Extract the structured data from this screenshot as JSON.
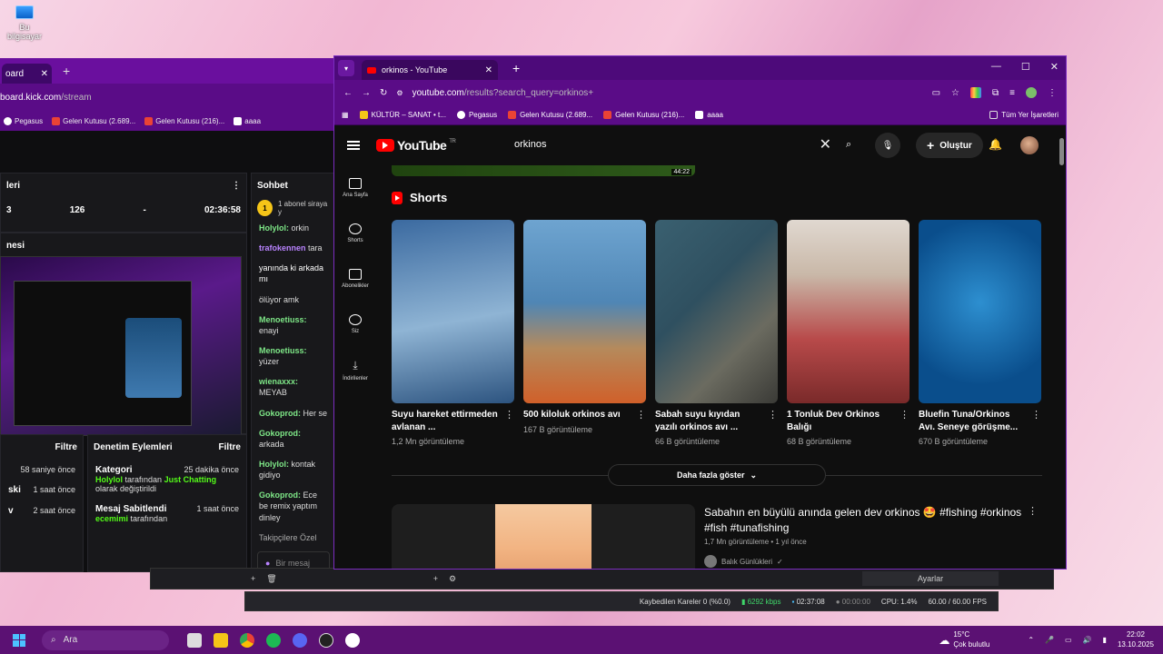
{
  "desktop": {
    "icon_label": "Bu bilgisayar"
  },
  "kick_window": {
    "tab_title": "oard",
    "url_host": "board.kick.com",
    "url_path": "/stream",
    "bookmarks": [
      {
        "label": "Pegasus",
        "color": "#ffffff"
      },
      {
        "label": "Gelen Kutusu (2.689...",
        "color": "#ea4335"
      },
      {
        "label": "Gelen Kutusu (216)...",
        "color": "#ea4335"
      },
      {
        "label": "aaaa",
        "color": "#ffffff"
      }
    ],
    "stats_header": "leri",
    "stats": [
      "3",
      "126",
      "-",
      "02:36:58"
    ],
    "preview_header": "nesi",
    "chat_header": "Sohbet",
    "subscriber_badge": "1",
    "subscriber_text": "1 abonel siraya y",
    "chat": [
      {
        "user": "Holylol:",
        "text": "orkin"
      },
      {
        "user": "trafokennen",
        "text": "tara"
      },
      {
        "user": "",
        "text": "yanında ki arkada mı"
      },
      {
        "user": "",
        "text": "ölüyor amk"
      },
      {
        "user": "Menoetiuss:",
        "text": "enayi"
      },
      {
        "user": "Menoetiuss:",
        "text": "yüzer"
      },
      {
        "user": "wienaxxx:",
        "text": "MEYAB"
      },
      {
        "user": "Gokoprod:",
        "text": "Her se"
      },
      {
        "user": "Gokoprod:",
        "text": "arkada"
      },
      {
        "user": "Holylol:",
        "text": "kontak gidiyo"
      },
      {
        "user": "Gokoprod:",
        "text": "Ece be remix yaptım dinley"
      }
    ],
    "chat_mode": "Takipçilere Özel",
    "chat_input_placeholder": "Bir mesaj",
    "left_filter": "Filtre",
    "left_events": [
      {
        "title": "",
        "time": "58 saniye önce"
      },
      {
        "title": "ski",
        "time": "1 saat önce"
      },
      {
        "title": "v",
        "time": "2 saat önce"
      }
    ],
    "mod_header": "Denetim Eylemleri",
    "mod_filter": "Filtre",
    "mod_actions": [
      {
        "title": "Kategori",
        "time": "25 dakika önce",
        "user": "Holylol",
        "mid": "tarafından",
        "target": "Just Chatting",
        "suffix": "olarak değiştirildi"
      },
      {
        "title": "Mesaj Sabitlendi",
        "time": "1 saat önce",
        "user": "ecemimi",
        "mid": "tarafından",
        "target": "",
        "suffix": ""
      }
    ]
  },
  "browser": {
    "tab_title": "orkinos - YouTube",
    "url_host": "youtube.com",
    "url_path": "/results?search_query=orkinos+",
    "bookmarks": [
      {
        "label": "KÜLTÜR – SANAT • t...",
        "color": "#f5c518"
      },
      {
        "label": "Pegasus",
        "color": "#ffffff"
      },
      {
        "label": "Gelen Kutusu (2.689...",
        "color": "#ea4335"
      },
      {
        "label": "Gelen Kutusu (216)...",
        "color": "#ea4335"
      },
      {
        "label": "aaaa",
        "color": "#ffffff"
      }
    ],
    "all_bookmarks": "Tüm Yer İşaretleri"
  },
  "youtube": {
    "logo_text": "YouTube",
    "logo_region": "TR",
    "search_query": "orkinos",
    "create_label": "Oluştur",
    "sidebar": [
      {
        "label": "Ana Sayfa",
        "icon": "home-icon"
      },
      {
        "label": "Shorts",
        "icon": "shorts-icon"
      },
      {
        "label": "Abonelikler",
        "icon": "subscriptions-icon"
      },
      {
        "label": "Siz",
        "icon": "you-icon"
      },
      {
        "label": "İndirilenler",
        "icon": "downloads-icon"
      }
    ],
    "top_video_duration": "44:22",
    "shorts_heading": "Shorts",
    "shorts": [
      {
        "title": "Suyu hareket ettirmeden avlanan ...",
        "views": "1,2 Mn görüntüleme",
        "c1": "#3b6aa0",
        "c2": "#8fb4d4"
      },
      {
        "title": "500 kiloluk orkinos avı",
        "views": "167 B görüntüleme",
        "c1": "#4f86b5",
        "c2": "#b58a5c"
      },
      {
        "title": "Sabah suyu kıyıdan yazılı orkinos avı ...",
        "views": "66 B görüntüleme",
        "c1": "#2f5060",
        "c2": "#6b6b60"
      },
      {
        "title": "1 Tonluk Dev Orkinos Balığı",
        "views": "68 B görüntüleme",
        "c1": "#b84a4a",
        "c2": "#e0d8d0"
      },
      {
        "title": "Bluefin Tuna/Orkinos Avı. Seneye görüşme...",
        "views": "670 B görüntüleme",
        "c1": "#0a4e8c",
        "c2": "#1d7bbf"
      }
    ],
    "more_button": "Daha fazla göster",
    "video": {
      "title": "Sabahın en büyülü anında gelen dev orkinos 🤩 #fishing #orkinos #fish #tunafishing",
      "views": "1,7 Mn görüntüleme",
      "age": "1 yıl önce",
      "channel": "Balık Günlükleri"
    }
  },
  "obs": {
    "settings_label": "Ayarlar",
    "dropped": "Kaybedilen Kareler 0 (%0.0)",
    "bitrate": "6292 kbps",
    "stream_time": "02:37:08",
    "rec_time": "00:00:00",
    "cpu": "CPU: 1.4%",
    "fps": "60.00 / 60.00 FPS"
  },
  "taskbar": {
    "search_placeholder": "Ara",
    "weather_temp": "15°C",
    "weather_desc": "Çok bulutlu",
    "time": "22:02",
    "date": "13.10.2025"
  }
}
